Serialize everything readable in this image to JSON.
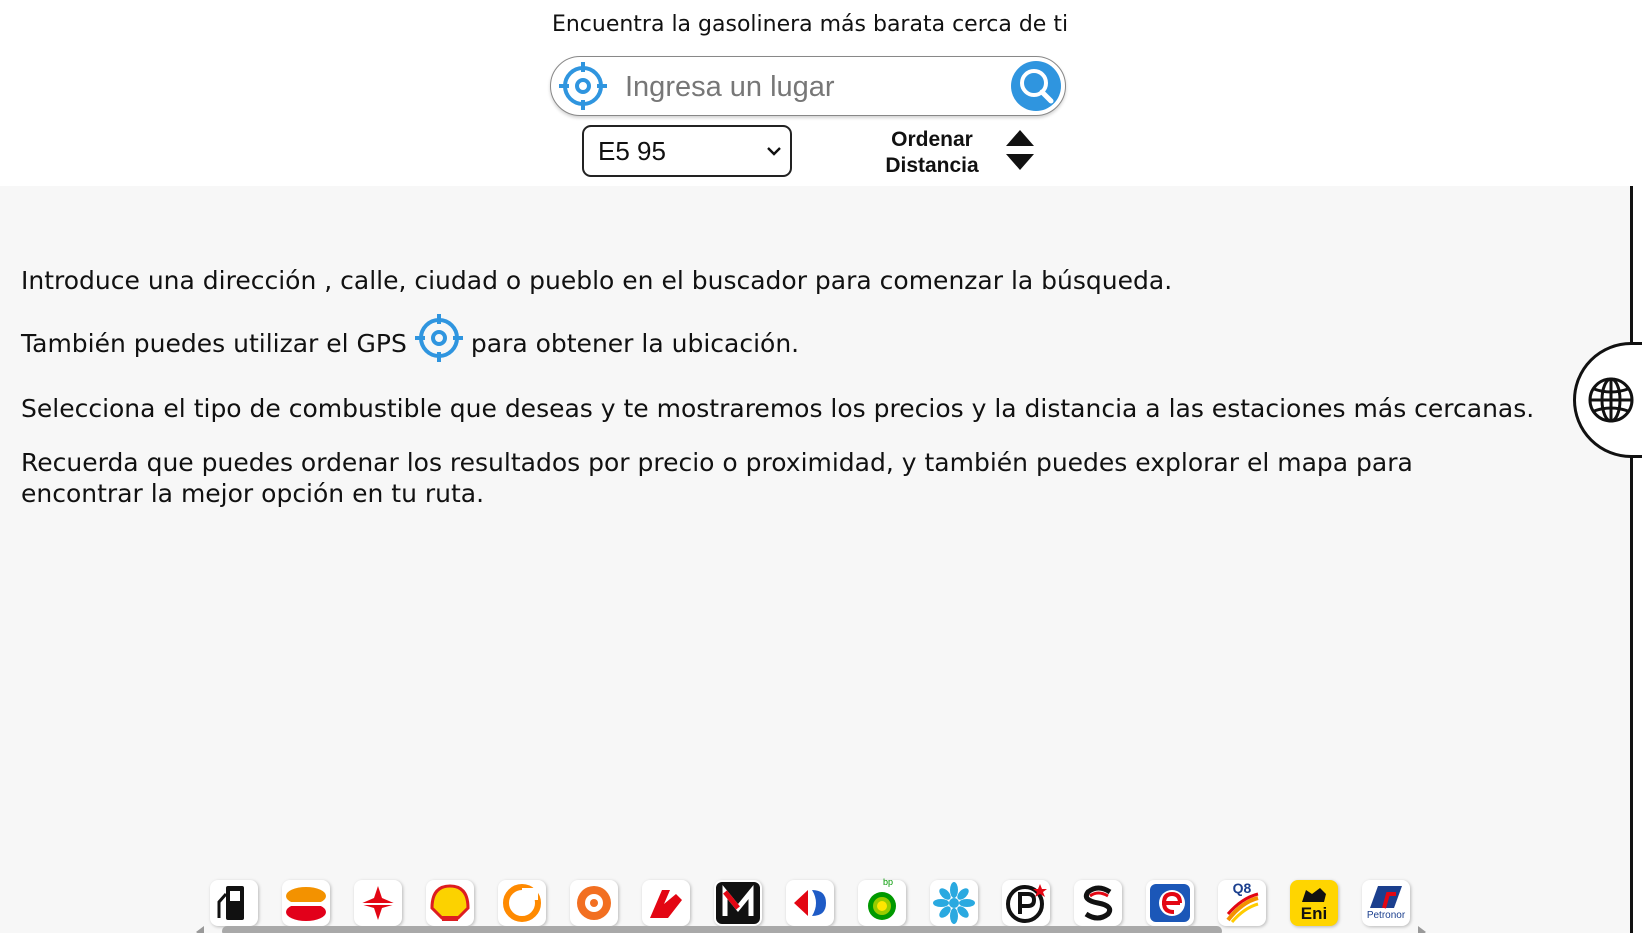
{
  "header": {
    "tagline": "Encuentra la gasolinera más barata cerca de ti"
  },
  "search": {
    "placeholder": "Ingresa un lugar",
    "value": ""
  },
  "fuel_select": {
    "selected": "E5 95"
  },
  "sort": {
    "label_line1": "Ordenar",
    "label_line2": "Distancia"
  },
  "instructions": {
    "p1": "Introduce una dirección , calle, ciudad o pueblo en el buscador para comenzar la búsqueda.",
    "p2_before": "También puedes utilizar el GPS",
    "p2_after": "para obtener la ubicación.",
    "p3": "Selecciona el tipo de combustible que deseas y te mostraremos los precios y la distancia a las estaciones más cercanas.",
    "p4_line1": "Recuerda que puedes ordenar los resultados por precio o proximidad, y también puedes explorar el mapa para",
    "p4_line2": "encontrar la mejor opción en tu ruta."
  },
  "brands": {
    "bp_text": "bp",
    "q8_text": "Q8",
    "eni_text": "Eni",
    "petronor_text": "Petronor"
  },
  "colors": {
    "accent_blue": "#2f95df",
    "main_bg": "#f7f7f7"
  },
  "icons": {
    "gps": "crosshair-icon",
    "search": "magnifier-icon",
    "language": "globe-icon",
    "sort": "sort-arrows-icon"
  }
}
